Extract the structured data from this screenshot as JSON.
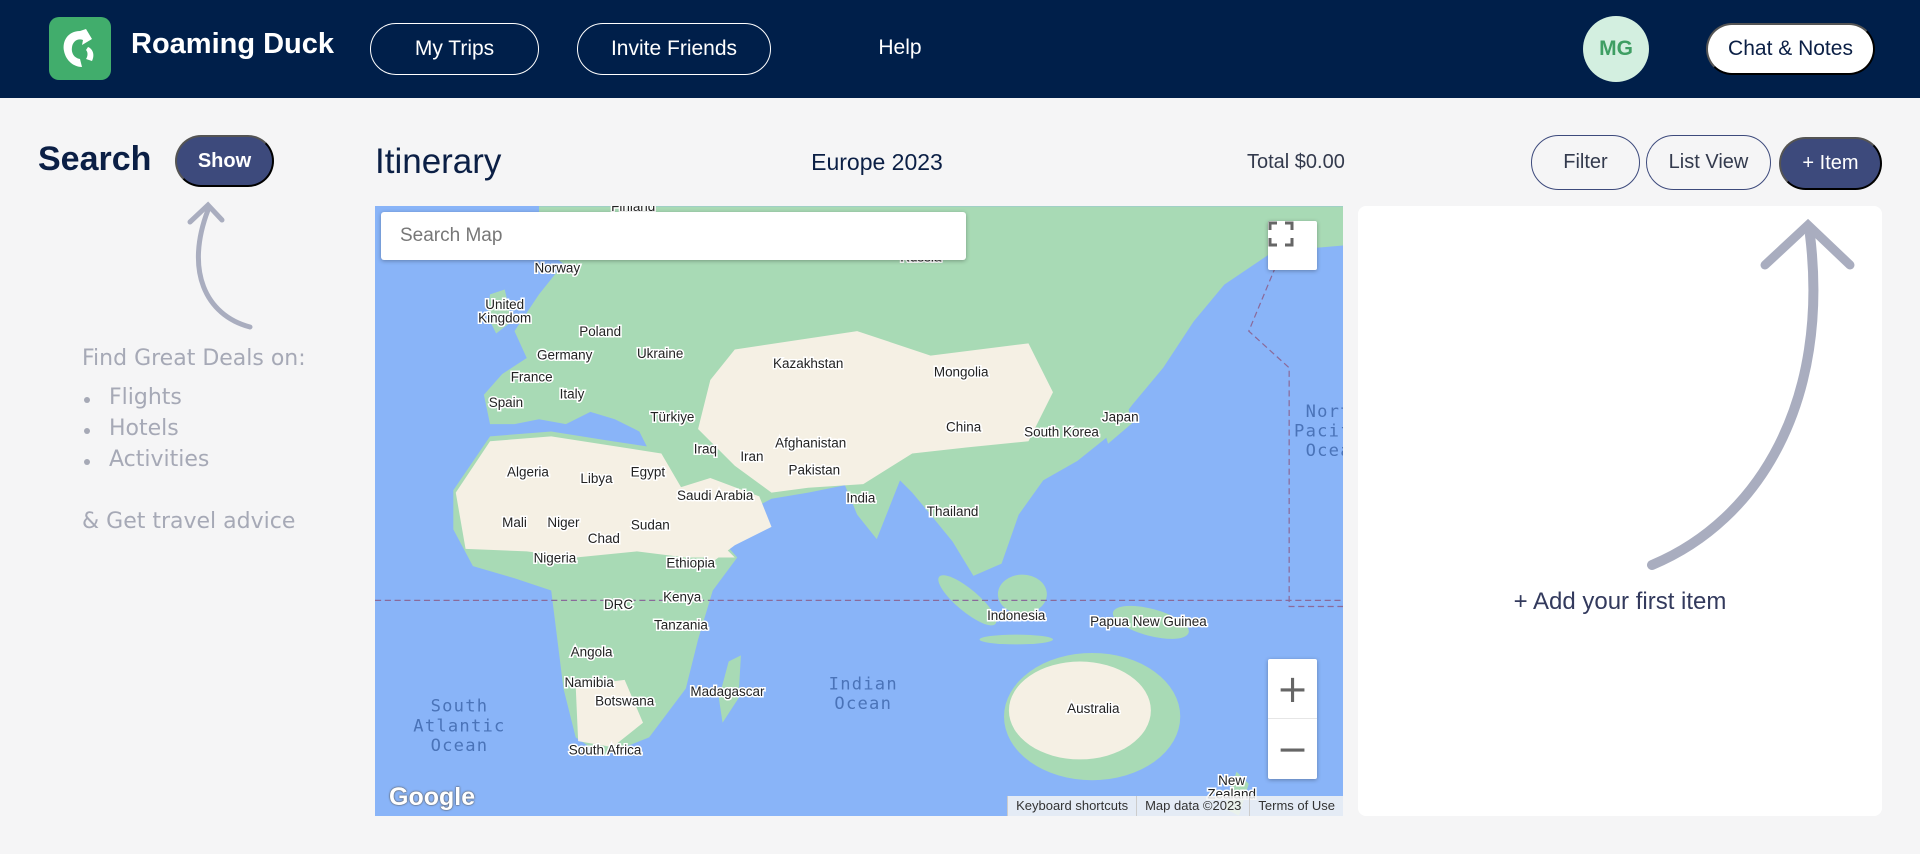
{
  "header": {
    "brand": "Roaming Duck",
    "nav": [
      {
        "label": "My Trips"
      },
      {
        "label": "Invite Friends"
      },
      {
        "label": "Help"
      }
    ],
    "avatar_initials": "MG",
    "chat_label": "Chat & Notes"
  },
  "search": {
    "title": "Search",
    "show_label": "Show",
    "deals_heading": "Find Great Deals on:",
    "deals": [
      "Flights",
      "Hotels",
      "Activities"
    ],
    "advice": "& Get travel advice"
  },
  "itinerary": {
    "title": "Itinerary",
    "trip_name": "Europe 2023",
    "total": "Total $0.00",
    "filter_label": "Filter",
    "list_view_label": "List View",
    "add_item_label": "+ Item",
    "empty_prompt": "+ Add your first item"
  },
  "map": {
    "search_placeholder": "Search Map",
    "zoom_in": "+",
    "zoom_out": "−",
    "logo": "Google",
    "attribution": [
      "Keyboard shortcuts",
      "Map data ©2023",
      "Terms of Use"
    ],
    "labels": [
      "Finland",
      "Russia",
      "Norway",
      "United Kingdom",
      "Poland",
      "Germany",
      "Ukraine",
      "France",
      "Italy",
      "Spain",
      "Kazakhstan",
      "Mongolia",
      "Türkiye",
      "China",
      "South Korea",
      "Japan",
      "Afghanistan",
      "Iraq",
      "Iran",
      "Pakistan",
      "Algeria",
      "Libya",
      "Egypt",
      "Saudi Arabia",
      "India",
      "Thailand",
      "Mali",
      "Niger",
      "Sudan",
      "Chad",
      "Nigeria",
      "Ethiopia",
      "Kenya",
      "DRC",
      "Indonesia",
      "Papua New Guinea",
      "Tanzania",
      "Angola",
      "Namibia",
      "Botswana",
      "Madagascar",
      "Australia",
      "South Africa",
      "New Zealand"
    ],
    "oceans": [
      "Indian Ocean",
      "South Atlantic Ocean",
      "North Pacific Ocean"
    ]
  },
  "colors": {
    "header_bg": "#001f4a",
    "accent": "#3d4a7c",
    "logo_green": "#41ad6c",
    "ocean": "#89b4f8",
    "land": "#a8dab5",
    "desert": "#f5f0e4"
  }
}
